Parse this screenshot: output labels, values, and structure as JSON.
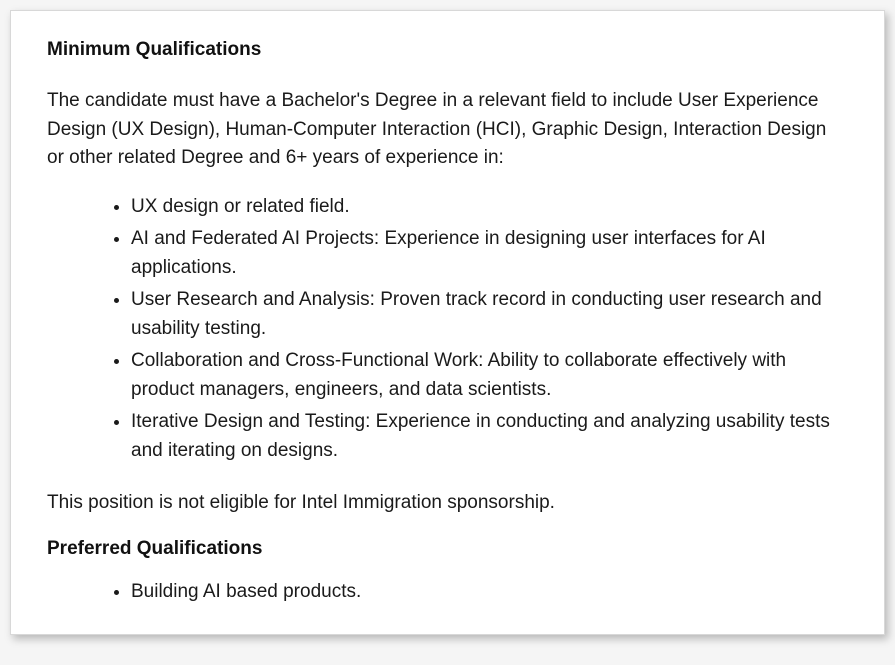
{
  "minimum": {
    "heading": "Minimum Qualifications",
    "intro": "The candidate must have a Bachelor's Degree in a relevant field to include User Experience Design (UX Design), Human-Computer Interaction (HCI), Graphic Design, Interaction Design or other related Degree and 6+ years of experience in:",
    "items": [
      "UX design or related field.",
      "AI and Federated AI Projects: Experience in designing user interfaces for AI applications.",
      "User Research and Analysis: Proven track record in conducting user research and usability testing.",
      "Collaboration and Cross-Functional Work: Ability to collaborate effectively with product managers, engineers, and data scientists.",
      "Iterative Design and Testing: Experience in conducting and analyzing usability tests and iterating on designs."
    ],
    "note": "This position is not eligible for Intel Immigration sponsorship."
  },
  "preferred": {
    "heading": "Preferred Qualifications",
    "items": [
      "Building AI based products."
    ]
  }
}
